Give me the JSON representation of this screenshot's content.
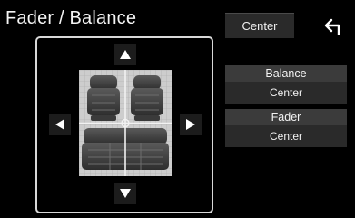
{
  "header": {
    "title": "Fader / Balance",
    "center_label": "Center",
    "back_icon": "back-arrow-icon"
  },
  "controls": {
    "up_icon": "arrow-up-icon",
    "down_icon": "arrow-down-icon",
    "left_icon": "arrow-left-icon",
    "right_icon": "arrow-right-icon"
  },
  "balance": {
    "label": "Balance",
    "value": "Center"
  },
  "fader": {
    "label": "Fader",
    "value": "Center"
  }
}
